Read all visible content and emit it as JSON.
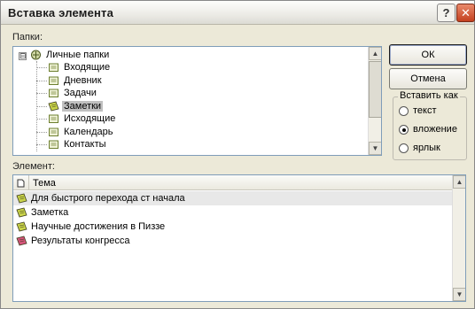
{
  "window": {
    "title": "Вставка элемента",
    "help_symbol": "?",
    "close_symbol": "✕"
  },
  "folders": {
    "label": "Папки:",
    "expander_symbol": "⊟",
    "root": "Личные папки",
    "items": [
      {
        "label": "Входящие",
        "icon": "inbox-icon"
      },
      {
        "label": "Дневник",
        "icon": "journal-icon"
      },
      {
        "label": "Задачи",
        "icon": "tasks-icon"
      },
      {
        "label": "Заметки",
        "icon": "notes-icon",
        "selected": true
      },
      {
        "label": "Исходящие",
        "icon": "outbox-icon"
      },
      {
        "label": "Календарь",
        "icon": "calendar-icon"
      },
      {
        "label": "Контакты",
        "icon": "contacts-icon"
      }
    ]
  },
  "buttons": {
    "ok": "ОК",
    "cancel": "Отмена"
  },
  "insert_as": {
    "title": "Вставить как",
    "options": [
      {
        "label": "текст",
        "checked": false
      },
      {
        "label": "вложение",
        "checked": true
      },
      {
        "label": "ярлык",
        "checked": false
      }
    ]
  },
  "items": {
    "label": "Элемент:",
    "columns": [
      "Тема"
    ],
    "rows": [
      {
        "subject": "Для быстрого перехода ст начала",
        "icon": "note-icon",
        "selected": true
      },
      {
        "subject": "Заметка",
        "icon": "note-icon"
      },
      {
        "subject": "Научные достижения в Пиззе",
        "icon": "note-icon"
      },
      {
        "subject": "Результаты конгресса",
        "icon": "note-pink-icon"
      }
    ]
  },
  "colors": {
    "note_yellow": "#c9d34a",
    "note_pink": "#d4547a",
    "tree_icon": "#6d7f2f"
  }
}
